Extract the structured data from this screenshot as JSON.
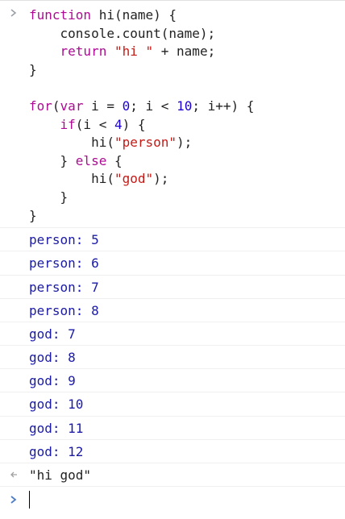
{
  "code_block": {
    "lines": [
      [
        {
          "t": "function",
          "c": "kw"
        },
        {
          "t": " hi(name) {",
          "c": ""
        }
      ],
      [
        {
          "t": "    console.count(name);",
          "c": ""
        }
      ],
      [
        {
          "t": "    ",
          "c": ""
        },
        {
          "t": "return",
          "c": "kw"
        },
        {
          "t": " ",
          "c": ""
        },
        {
          "t": "\"hi \"",
          "c": "str"
        },
        {
          "t": " + name;",
          "c": ""
        }
      ],
      [
        {
          "t": "}",
          "c": ""
        }
      ],
      [
        {
          "t": "",
          "c": ""
        }
      ],
      [
        {
          "t": "for",
          "c": "kw"
        },
        {
          "t": "(",
          "c": ""
        },
        {
          "t": "var",
          "c": "kw"
        },
        {
          "t": " i = ",
          "c": ""
        },
        {
          "t": "0",
          "c": "num"
        },
        {
          "t": "; i < ",
          "c": ""
        },
        {
          "t": "10",
          "c": "num"
        },
        {
          "t": "; i++) {",
          "c": ""
        }
      ],
      [
        {
          "t": "    ",
          "c": ""
        },
        {
          "t": "if",
          "c": "kw"
        },
        {
          "t": "(i < ",
          "c": ""
        },
        {
          "t": "4",
          "c": "num"
        },
        {
          "t": ") {",
          "c": ""
        }
      ],
      [
        {
          "t": "        hi(",
          "c": ""
        },
        {
          "t": "\"person\"",
          "c": "str"
        },
        {
          "t": ");",
          "c": ""
        }
      ],
      [
        {
          "t": "    } ",
          "c": ""
        },
        {
          "t": "else",
          "c": "kw"
        },
        {
          "t": " {",
          "c": ""
        }
      ],
      [
        {
          "t": "        hi(",
          "c": ""
        },
        {
          "t": "\"god\"",
          "c": "str"
        },
        {
          "t": ");",
          "c": ""
        }
      ],
      [
        {
          "t": "    }",
          "c": ""
        }
      ],
      [
        {
          "t": "}",
          "c": ""
        }
      ]
    ]
  },
  "logs": [
    "person: 5",
    "person: 6",
    "person: 7",
    "person: 8",
    "god: 7",
    "god: 8",
    "god: 9",
    "god: 10",
    "god: 11",
    "god: 12"
  ],
  "result": "\"hi god\"",
  "colors": {
    "keyword": "#aa0d91",
    "string": "#c41a16",
    "number": "#1c00cf",
    "log_text": "#1a1aa6",
    "prompt_arrow": "#4f7dc4",
    "result_arrow": "#a0a0a0"
  },
  "icons": {
    "input_prompt": "chevron-right-icon",
    "result_marker": "result-arrow-icon",
    "active_prompt": "chevron-right-icon"
  }
}
